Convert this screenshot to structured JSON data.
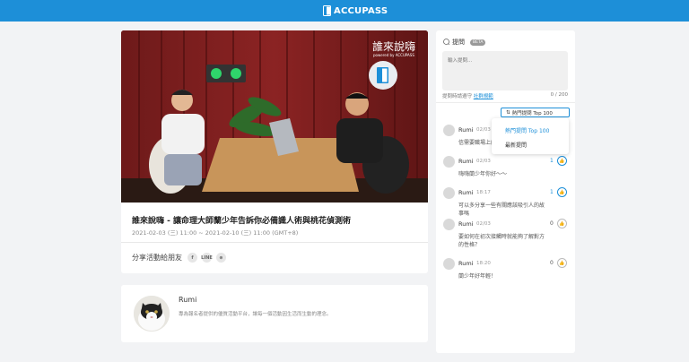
{
  "brand": {
    "name": "ACCUPASS",
    "color": "#1d8fd8"
  },
  "event": {
    "title": "誰來說嗨 - 讓命理大師蘭少年告訴你必備識人術與桃花偵測術",
    "date": "2021-02-03 (三) 11:00 ~ 2021-02-10 (三) 11:00 (GMT+8)",
    "video_overlay_title": "誰來說嗨",
    "video_overlay_sub": "powered by ACCUPASS",
    "share_label": "分享活動給朋友",
    "share_buttons": [
      "f",
      "LINE",
      "⊕"
    ]
  },
  "host": {
    "name": "Rumi",
    "description": "專為報名者提供的優質活動平台，讓每一個活動因生活而生動的理念。"
  },
  "qa": {
    "title": "提問",
    "badge": "BETA",
    "input_placeholder": "輸入提問...",
    "rules_prefix": "提問時請遵守",
    "rules_link": "社群規範",
    "char_count": "0 / 200",
    "sort_selected": "熱門提問 Top 100",
    "sort_options": [
      "熱門提問 Top 100",
      "最新提問"
    ],
    "items": [
      {
        "name": "Rumi",
        "time": "02/03",
        "text": "信需要職場上的...",
        "likes": "1",
        "liked": true
      },
      {
        "name": "Rumi",
        "time": "02/03",
        "text": "嗨嗨蘭少年你好～～",
        "likes": "1",
        "liked": true
      },
      {
        "name": "Rumi",
        "time": "18:17",
        "text": "可以多分享一些有關應該吸引人的故事嗎",
        "likes": "1",
        "liked": true
      },
      {
        "name": "Rumi",
        "time": "02/03",
        "text": "要如何在初次接觸時就能夠了解對方的性格？",
        "likes": "0",
        "liked": false
      },
      {
        "name": "Rumi",
        "time": "18:20",
        "text": "蘭少年好年輕！",
        "likes": "0",
        "liked": false
      }
    ]
  }
}
